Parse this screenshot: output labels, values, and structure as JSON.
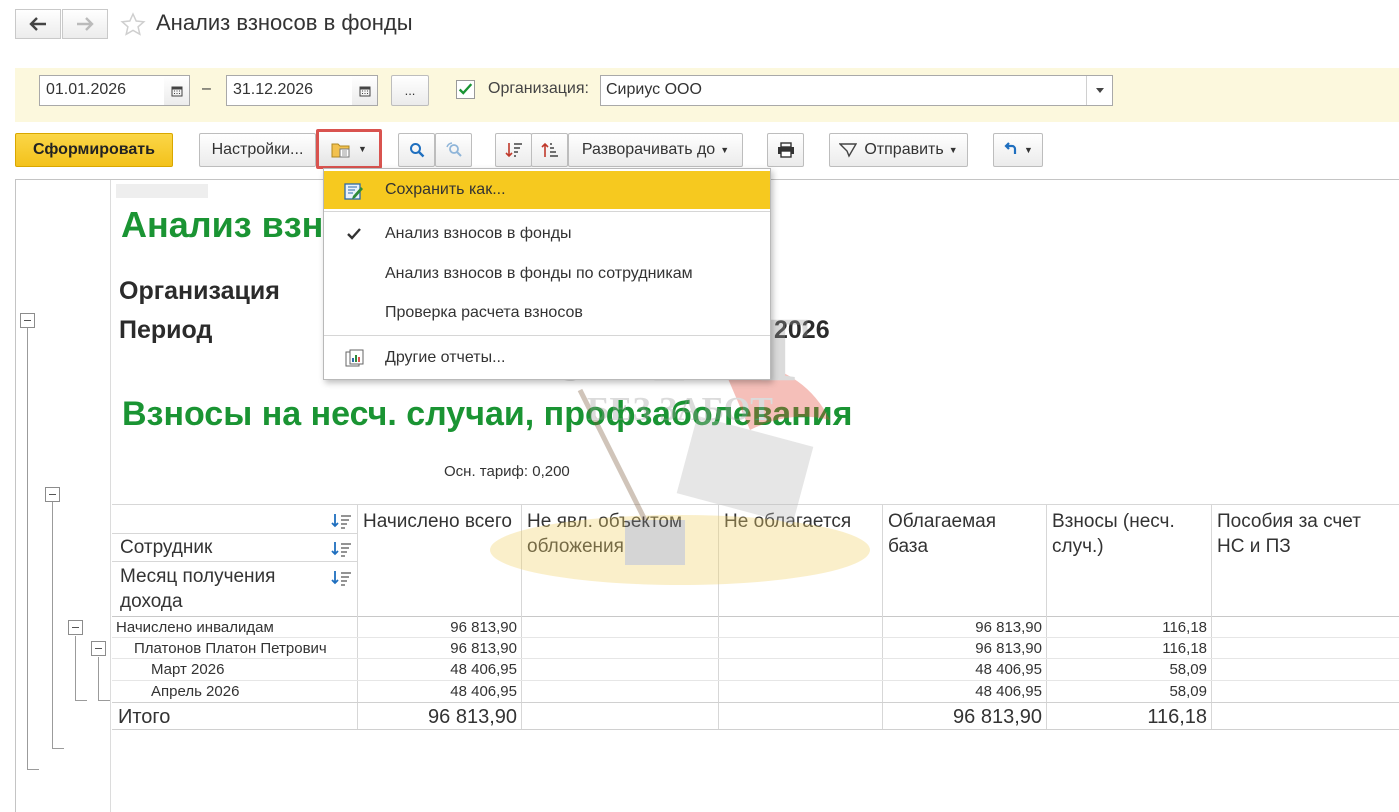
{
  "window": {
    "title": "Анализ взносов в фонды",
    "back_icon": "arrow-left-icon",
    "forward_icon": "arrow-right-icon",
    "favorite_icon": "star-icon"
  },
  "params": {
    "date_from": "01.01.2026",
    "date_to": "31.12.2026",
    "dash": "–",
    "more_label": "...",
    "org_checked": true,
    "org_label": "Организация:",
    "org_value": "Сириус ООО"
  },
  "toolbar": {
    "generate_label": "Сформировать",
    "settings_label": "Настройки...",
    "expand_label": "Разворачивать до",
    "send_label": "Отправить"
  },
  "menu": {
    "items": [
      {
        "label": "Сохранить как...",
        "icon": "save-edit-icon",
        "highlighted": true
      },
      {
        "label": "Анализ взносов в фонды",
        "icon": "checkmark-icon",
        "checked": true
      },
      {
        "label": "Анализ взносов в фонды по сотрудникам"
      },
      {
        "label": "Проверка расчета взносов"
      },
      {
        "label": "Другие отчеты...",
        "icon": "reports-icon"
      }
    ]
  },
  "report": {
    "title": "Анализ взн",
    "org_label": "Организация",
    "period_label": "Период",
    "period_value_tail": "2026",
    "section_title": "Взносы на несч. случаи, профзаболевания",
    "tariff": "Осн. тариф: 0,200",
    "columns": {
      "employee": "Сотрудник",
      "month": "Месяц получения дохода",
      "accrued": "Начислено всего",
      "not_object": "Не явл. объектом обложения",
      "not_taxed": "Не облагается",
      "taxable_base": "Облагаемая база",
      "contributions": "Взносы (несч. случ.)",
      "benefits": "Пособия за счет НС и ПЗ"
    },
    "rows": [
      {
        "label": "Начислено инвалидам",
        "accrued": "96 813,90",
        "base": "96 813,90",
        "contrib": "116,18"
      },
      {
        "label": "Платонов Платон Петрович",
        "accrued": "96 813,90",
        "base": "96 813,90",
        "contrib": "116,18"
      },
      {
        "label": "Март 2026",
        "accrued": "48 406,95",
        "base": "48 406,95",
        "contrib": "58,09"
      },
      {
        "label": "Апрель 2026",
        "accrued": "48 406,95",
        "base": "48 406,95",
        "contrib": "58,09"
      }
    ],
    "total": {
      "label": "Итого",
      "accrued": "96 813,90",
      "base": "96 813,90",
      "contrib": "116,18"
    }
  },
  "watermark": {
    "line1": "УЧЕТ",
    "line2": "БЕЗ ЗАБОТ"
  },
  "colors": {
    "accent_green": "#1a9433",
    "generate_yellow": "#f3c21c",
    "menu_highlight": "#f6c91f",
    "param_bg": "#fcf8dd",
    "selected_btn_border": "#d9534f"
  }
}
